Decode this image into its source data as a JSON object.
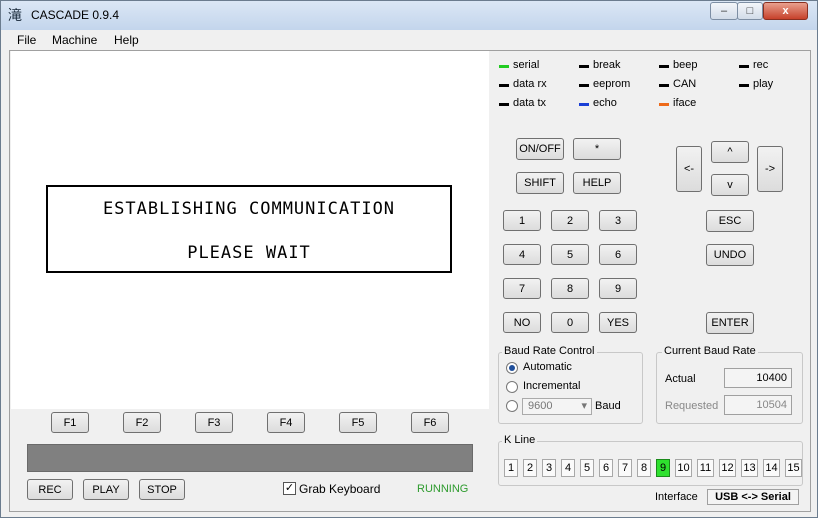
{
  "window": {
    "title": "CASCADE 0.9.4",
    "icon": "kanji-app-icon",
    "controls": {
      "minimize": "–",
      "maximize": "□",
      "close": "x"
    }
  },
  "menu": [
    "File",
    "Machine",
    "Help"
  ],
  "lcd": {
    "line1": "ESTABLISHING COMMUNICATION",
    "line2": "PLEASE WAIT"
  },
  "fkeys": [
    "F1",
    "F2",
    "F3",
    "F4",
    "F5",
    "F6"
  ],
  "controls": {
    "rec": "REC",
    "play": "PLAY",
    "stop": "STOP",
    "grab_keyboard": "Grab Keyboard",
    "grab_checked": "✓",
    "status": "RUNNING"
  },
  "indicators": [
    {
      "label": "serial",
      "color": "#22cc22"
    },
    {
      "label": "break",
      "color": "#000000"
    },
    {
      "label": "beep",
      "color": "#000000"
    },
    {
      "label": "rec",
      "color": "#000000"
    },
    {
      "label": "data rx",
      "color": "#000000"
    },
    {
      "label": "eeprom",
      "color": "#000000"
    },
    {
      "label": "CAN",
      "color": "#000000"
    },
    {
      "label": "play",
      "color": "#000000"
    },
    {
      "label": "data tx",
      "color": "#000000"
    },
    {
      "label": "echo",
      "color": "#1a3fd6"
    },
    {
      "label": "iface",
      "color": "#ee6a1a"
    }
  ],
  "keys": {
    "onoff": "ON/OFF",
    "star": "*",
    "shift": "SHIFT",
    "help": "HELP",
    "left": "<-",
    "up": "^",
    "down": "v",
    "right": "->",
    "k1": "1",
    "k2": "2",
    "k3": "3",
    "k4": "4",
    "k5": "5",
    "k6": "6",
    "k7": "7",
    "k8": "8",
    "k9": "9",
    "no": "NO",
    "k0": "0",
    "yes": "YES",
    "esc": "ESC",
    "undo": "UNDO",
    "enter": "ENTER"
  },
  "baud_control": {
    "title": "Baud Rate Control",
    "automatic": "Automatic",
    "incremental": "Incremental",
    "fixed_value": "9600",
    "baud": "Baud",
    "dropdown_arrow": "▾"
  },
  "current_baud": {
    "title": "Current Baud Rate",
    "actual_label": "Actual",
    "actual": "10400",
    "requested_label": "Requested",
    "requested": "10504"
  },
  "kline": {
    "title": "K Line",
    "lines": [
      "1",
      "2",
      "3",
      "4",
      "5",
      "6",
      "7",
      "8",
      "9",
      "10",
      "11",
      "12",
      "13",
      "14",
      "15"
    ],
    "active": "9"
  },
  "interface": {
    "label": "Interface",
    "value": "USB <-> Serial"
  }
}
